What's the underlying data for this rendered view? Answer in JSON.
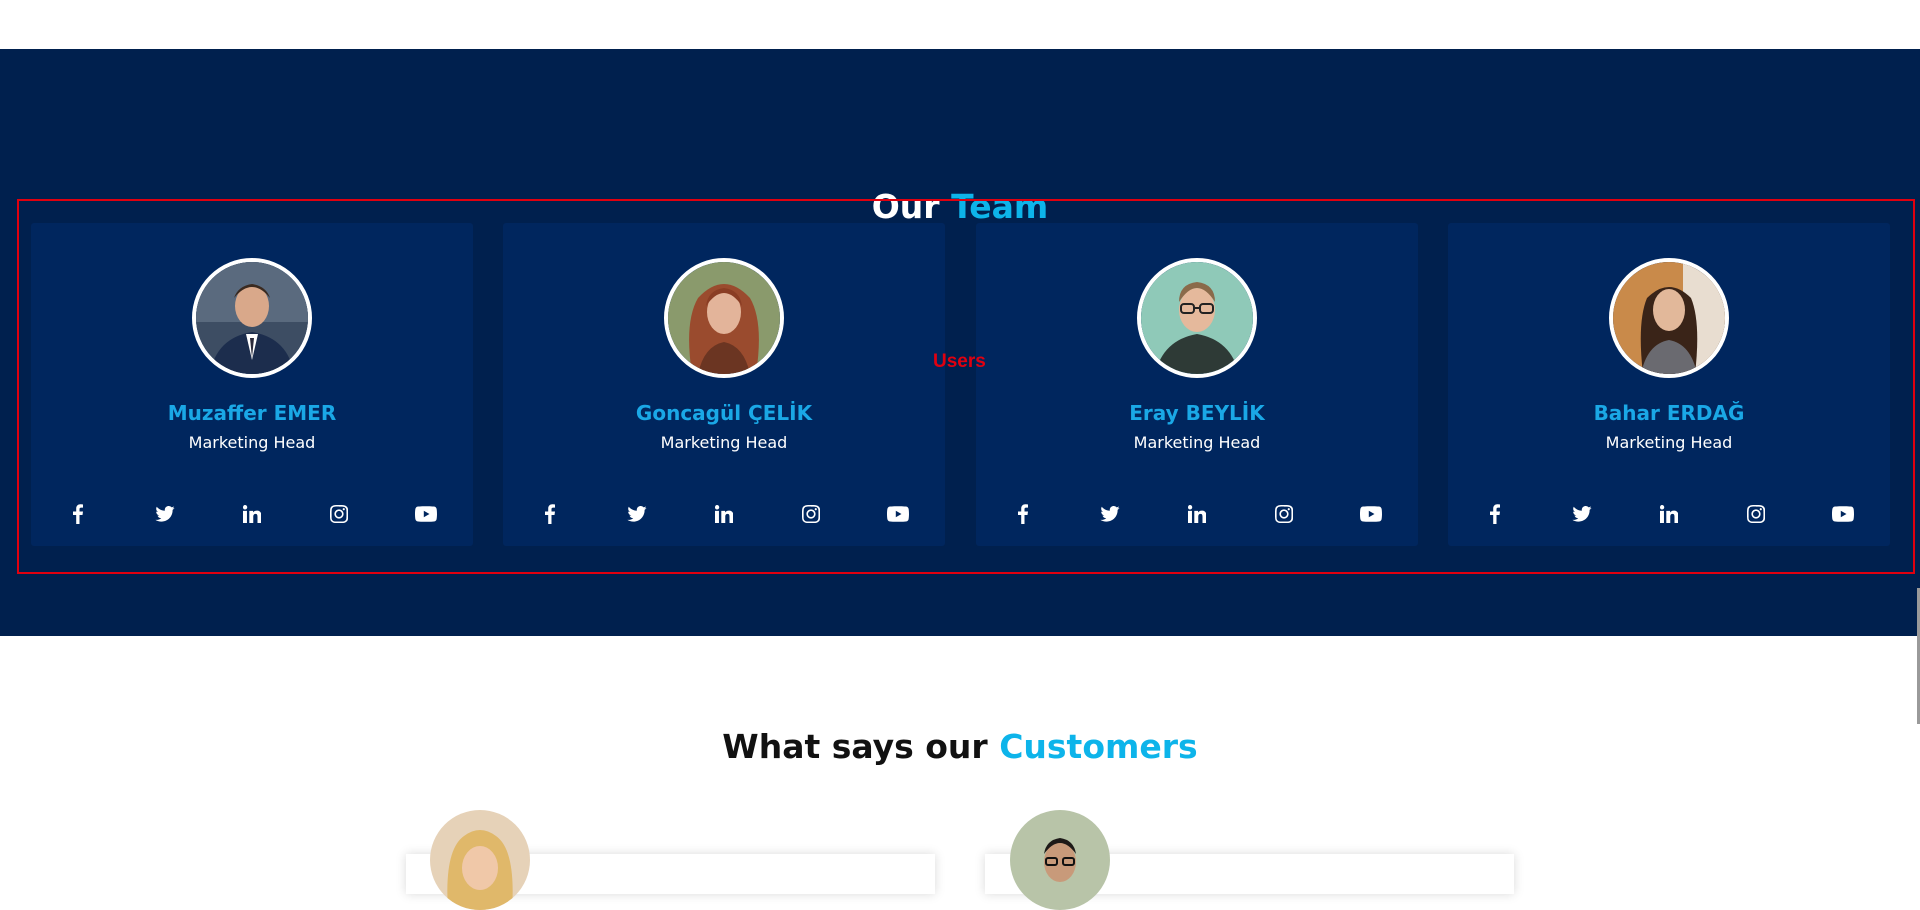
{
  "team": {
    "heading_main": "Our",
    "heading_accent": "Team",
    "highlight_label": "Users",
    "members": [
      {
        "name": "Muzaffer EMER",
        "role": "Marketing Head",
        "avatar": "man-suit-photo"
      },
      {
        "name": "Goncagül ÇELİK",
        "role": "Marketing Head",
        "avatar": "woman-red-hair-photo"
      },
      {
        "name": "Eray BEYLİK",
        "role": "Marketing Head",
        "avatar": "man-glasses-photo"
      },
      {
        "name": "Bahar ERDAĞ",
        "role": "Marketing Head",
        "avatar": "woman-dark-hair-photo"
      }
    ],
    "social_icons": [
      "facebook-icon",
      "twitter-icon",
      "linkedin-icon",
      "instagram-icon",
      "youtube-icon"
    ]
  },
  "customers": {
    "heading_main": "What says our",
    "heading_accent": "Customers"
  },
  "colors": {
    "section_bg": "#00204e",
    "card_bg": "#00265e",
    "accent": "#0db4ea",
    "highlight": "#e00010"
  }
}
